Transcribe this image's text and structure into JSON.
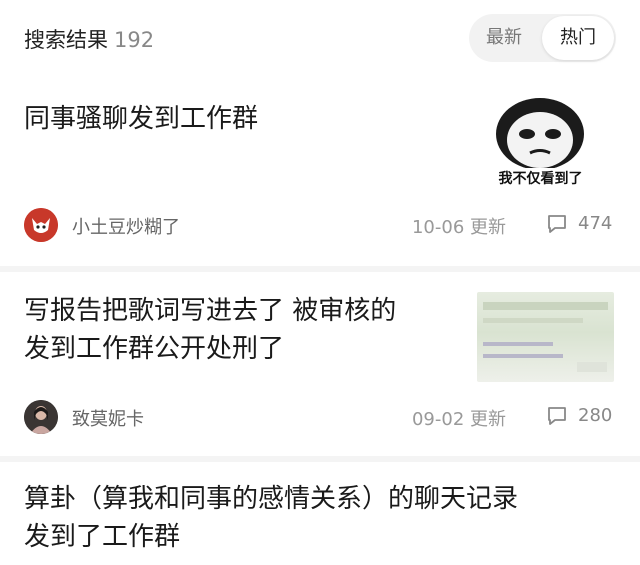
{
  "header": {
    "title": "搜索结果",
    "count": "192",
    "sort_latest": "最新",
    "sort_hot": "热门"
  },
  "posts": [
    {
      "title_lines": [
        "同事骚聊发到工作群"
      ],
      "thumb_caption": "我不仅看到了",
      "author": "小土豆炒糊了",
      "date": "10-06 更新",
      "comments": "474"
    },
    {
      "title_lines": [
        "写报告把歌词写进去了 被审核的",
        "发到工作群公开处刑了"
      ],
      "author": "致莫妮卡",
      "date": "09-02 更新",
      "comments": "280"
    },
    {
      "title_lines": [
        "算卦（算我和同事的感情关系）的聊天记录",
        "发到了工作群"
      ]
    }
  ],
  "icons": {
    "comment": "comment-bubble-icon",
    "avatar1": "fox-avatar-icon",
    "avatar2": "portrait-avatar-icon"
  },
  "colors": {
    "text_primary": "#1a1a1a",
    "text_secondary": "#888888",
    "toggle_bg": "#f2f2f2",
    "divider": "#f4f4f4",
    "avatar_red": "#c8382a"
  }
}
